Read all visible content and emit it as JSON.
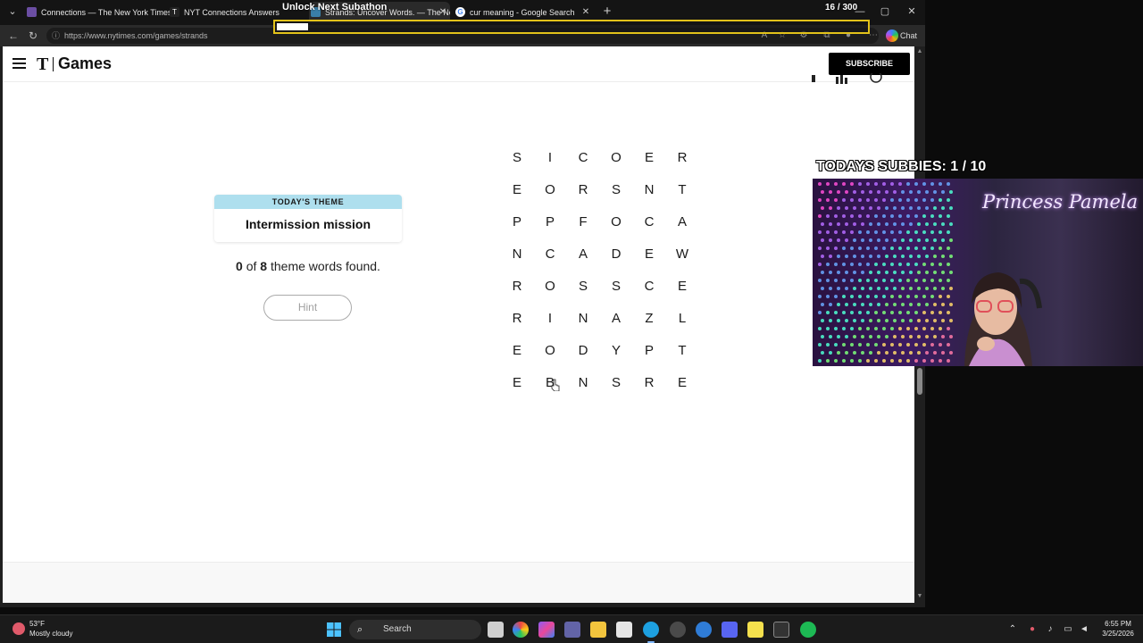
{
  "browser": {
    "tabs": [
      {
        "title": "Connections — The New York Times",
        "favicon_color": "#6b4ea3"
      },
      {
        "title": "NYT Connections Answers for Mar",
        "favicon_color": "#222222"
      },
      {
        "title": "Strands: Uncover Words. — The New York Times",
        "favicon_color": "#3a7fa8"
      },
      {
        "title": "cur meaning - Google Search",
        "favicon_color": "#ffffff"
      }
    ],
    "url": "https://www.nytimes.com/games/strands",
    "copilot_label": "Chat"
  },
  "stream_overlay": {
    "goal_title": "Unlock Next Subathon",
    "goal_count": "16 / 300",
    "goal_progress": 0.053,
    "subbies_label": "TODAYS SUBBIES:",
    "subbies_count": "1 / 10",
    "webcam_title": "Princess Pamela"
  },
  "site": {
    "logo": "T",
    "games_label": "Games",
    "subscribe_label": "SUBSCRIBE"
  },
  "game": {
    "theme_label": "TODAY'S THEME",
    "theme": "Intermission mission",
    "found_count": "0",
    "total_count": "8",
    "found_suffix": "theme words found.",
    "of_label": "of",
    "hint_label": "Hint",
    "grid": [
      [
        "S",
        "I",
        "C",
        "O",
        "E",
        "R"
      ],
      [
        "E",
        "O",
        "R",
        "S",
        "N",
        "T"
      ],
      [
        "P",
        "P",
        "F",
        "O",
        "C",
        "A"
      ],
      [
        "N",
        "C",
        "A",
        "D",
        "E",
        "W"
      ],
      [
        "R",
        "O",
        "S",
        "S",
        "C",
        "E"
      ],
      [
        "R",
        "I",
        "N",
        "A",
        "Z",
        "L"
      ],
      [
        "E",
        "O",
        "D",
        "Y",
        "P",
        "T"
      ],
      [
        "E",
        "B",
        "N",
        "S",
        "R",
        "E"
      ]
    ]
  },
  "taskbar": {
    "weather_temp": "53°F",
    "weather_desc": "Mostly cloudy",
    "search_label": "Search",
    "time": "6:55 PM",
    "date": "3/25/2026"
  },
  "colors": {
    "theme_header_bg": "#aedfee",
    "goal_border": "#e2c21a",
    "subscribe_bg": "#000000"
  }
}
